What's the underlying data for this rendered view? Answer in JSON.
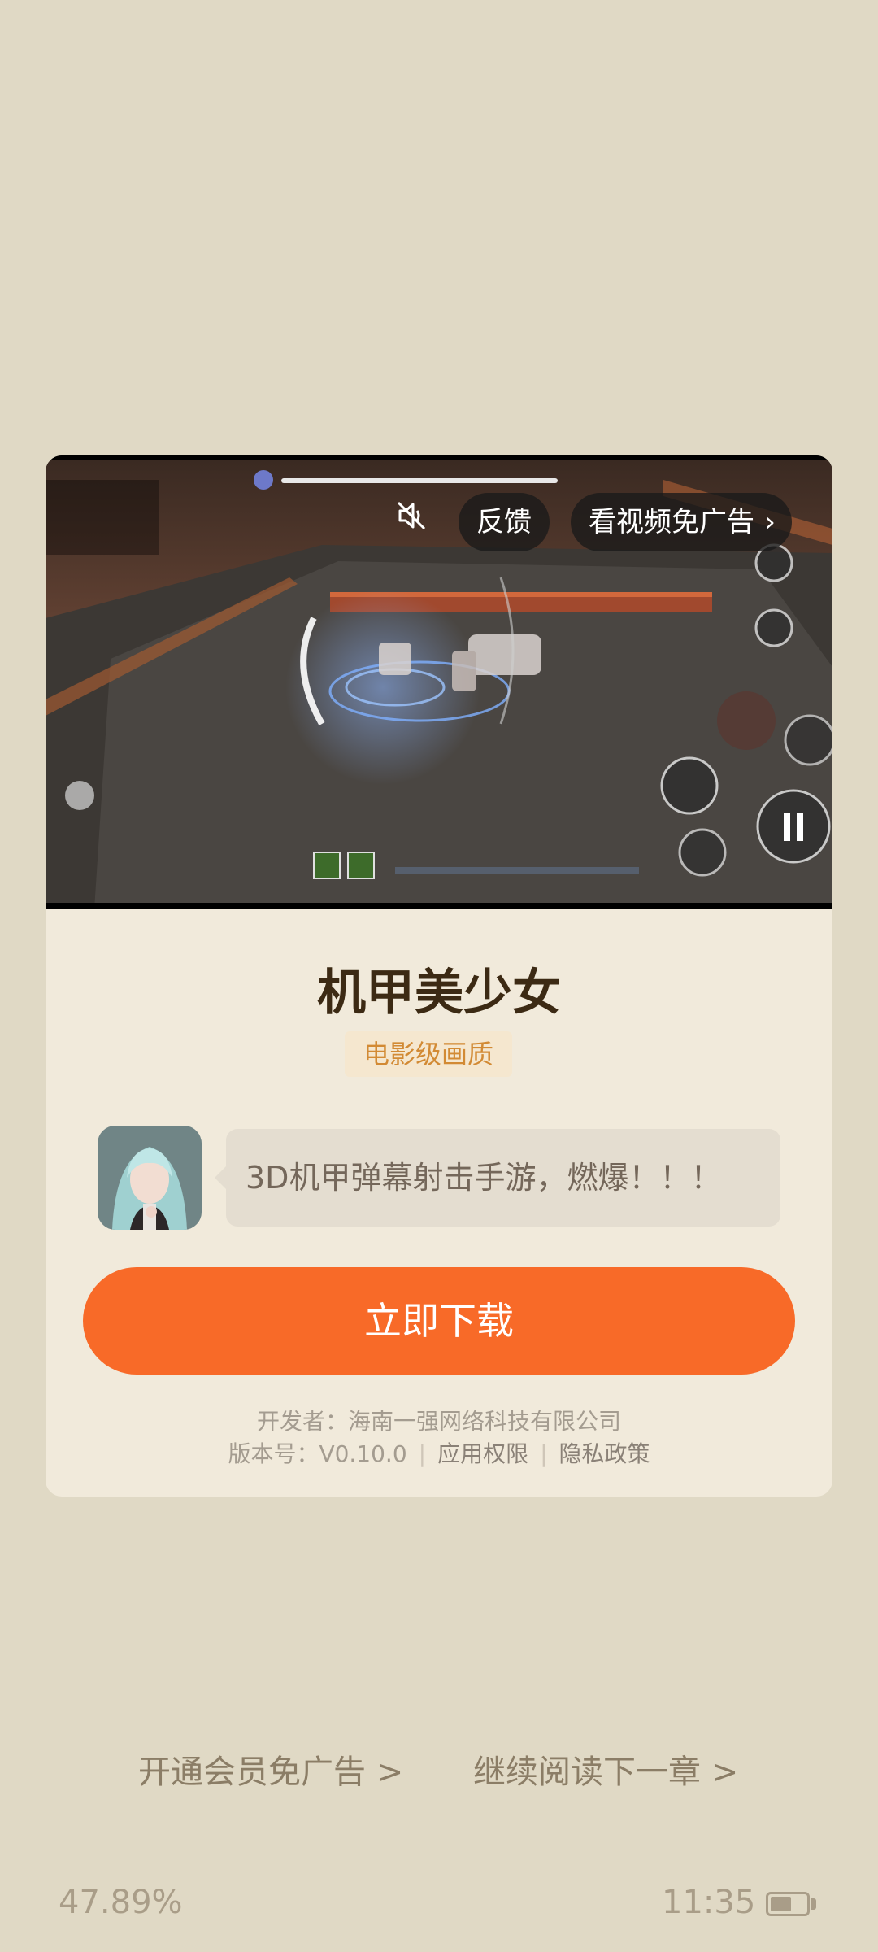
{
  "ad": {
    "video": {
      "mute_icon": "speaker-muted-icon",
      "feedback_label": "反馈",
      "no_ads_label": "看视频免广告",
      "chevron": "›"
    },
    "title": "机甲美少女",
    "tag": "电影级画质",
    "description": "3D机甲弹幕射击手游，燃爆！！！",
    "download_label": "立即下载",
    "developer": "开发者：海南一强网络科技有限公司",
    "version": "版本号：V0.10.0",
    "permissions_label": "应用权限",
    "privacy_label": "隐私政策",
    "colors": {
      "download_button": "#f86a28",
      "tag_text": "#d28a34",
      "card_bg": "#f1eadb"
    }
  },
  "reader": {
    "vip_link": "开通会员免广告 >",
    "next_chapter_link": "继续阅读下一章 >",
    "progress": "47.89%",
    "time": "11:35",
    "battery_level": 0.6
  },
  "page": {
    "background": "#e0d9c5"
  }
}
